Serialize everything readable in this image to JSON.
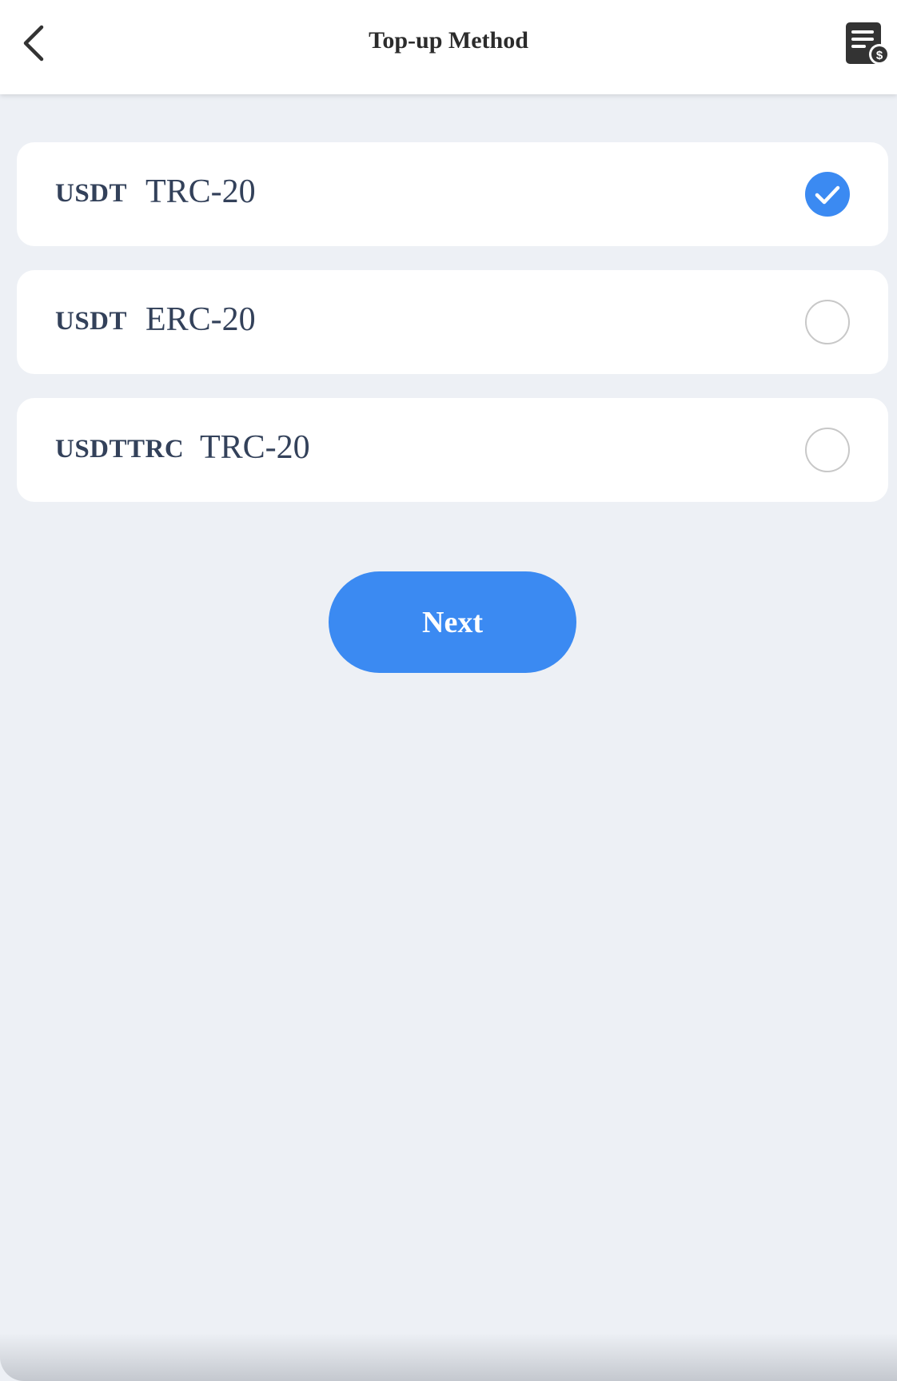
{
  "header": {
    "title": "Top-up Method",
    "back_icon": "chevron-left-icon",
    "records_icon": "invoice-dollar-icon"
  },
  "options": [
    {
      "coin": "USDT",
      "network": "TRC-20",
      "selected": true
    },
    {
      "coin": "USDT",
      "network": "ERC-20",
      "selected": false
    },
    {
      "coin": "USDTTRC",
      "network": "TRC-20",
      "selected": false
    }
  ],
  "actions": {
    "next_label": "Next"
  },
  "colors": {
    "accent": "#3b8af2",
    "background": "#edf0f5",
    "text": "#33415a",
    "radio_border": "#c8c8c8"
  }
}
